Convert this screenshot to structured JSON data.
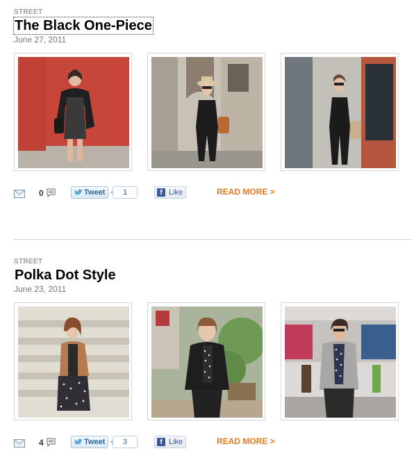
{
  "posts": [
    {
      "category": "STREET",
      "title": "The Black One-Piece",
      "date": "June 27, 2011",
      "photos": [
        {
          "subject": "woman-black-romper-red-wall",
          "bg": "#c8453a"
        },
        {
          "subject": "woman-black-jumpsuit-hat-building",
          "bg": "#b9b3a9"
        },
        {
          "subject": "woman-black-jumpsuit-storefront",
          "bg": "#8b8f93"
        }
      ],
      "comment_count": "0",
      "tweet_label": "Tweet",
      "tweet_count": "1",
      "like_label": "Like",
      "read_more": "READ MORE >"
    },
    {
      "category": "STREET",
      "title": "Polka Dot Style",
      "date": "June 23, 2011",
      "photos": [
        {
          "subject": "woman-tan-jacket-polka-dot-skirt",
          "bg": "#d9d4cb"
        },
        {
          "subject": "woman-black-jacket-polka-dot-street",
          "bg": "#8aa07a"
        },
        {
          "subject": "man-grey-blazer-polka-dot-shirt",
          "bg": "#c9c4c4"
        }
      ],
      "comment_count": "4",
      "tweet_label": "Tweet",
      "tweet_count": "3",
      "like_label": "Like",
      "read_more": "READ MORE >"
    }
  ],
  "colors": {
    "read_more": "#e07a1e",
    "category": "#9a9a9a",
    "facebook": "#3b5998",
    "twitter": "#2a6496"
  }
}
